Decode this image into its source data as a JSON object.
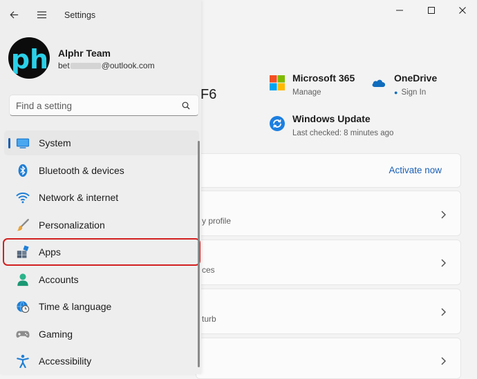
{
  "window": {
    "app_title": "Settings"
  },
  "account": {
    "avatar_letters": "ph",
    "name": "Alphr Team",
    "email_prefix": "bet",
    "email_suffix": "@outlook.com"
  },
  "search": {
    "placeholder": "Find a setting"
  },
  "nav": {
    "items": [
      {
        "label": "System",
        "icon": "system-icon",
        "active": true
      },
      {
        "label": "Bluetooth & devices",
        "icon": "bluetooth-icon"
      },
      {
        "label": "Network & internet",
        "icon": "wifi-icon"
      },
      {
        "label": "Personalization",
        "icon": "brush-icon"
      },
      {
        "label": "Apps",
        "icon": "apps-icon",
        "highlighted": true
      },
      {
        "label": "Accounts",
        "icon": "person-icon"
      },
      {
        "label": "Time & language",
        "icon": "globe-clock-icon"
      },
      {
        "label": "Gaming",
        "icon": "gamepad-icon"
      },
      {
        "label": "Accessibility",
        "icon": "accessibility-icon"
      }
    ]
  },
  "main": {
    "device_name_suffix": "F6",
    "services": [
      {
        "title": "Microsoft 365",
        "subtitle": "Manage",
        "icon": "microsoft-logo-icon"
      },
      {
        "title": "OneDrive",
        "subtitle": "Sign In",
        "icon": "cloud-icon"
      },
      {
        "title": "Windows Update",
        "subtitle": "Last checked: 8 minutes ago",
        "icon": "update-icon"
      }
    ],
    "activate_link": "Activate now",
    "cards": [
      {
        "subtitle": "y profile"
      },
      {
        "subtitle": "ces"
      },
      {
        "subtitle": "turb"
      },
      {
        "subtitle": ""
      }
    ]
  },
  "colors": {
    "accent": "#1a5fb4",
    "highlight_border": "#d32020"
  }
}
